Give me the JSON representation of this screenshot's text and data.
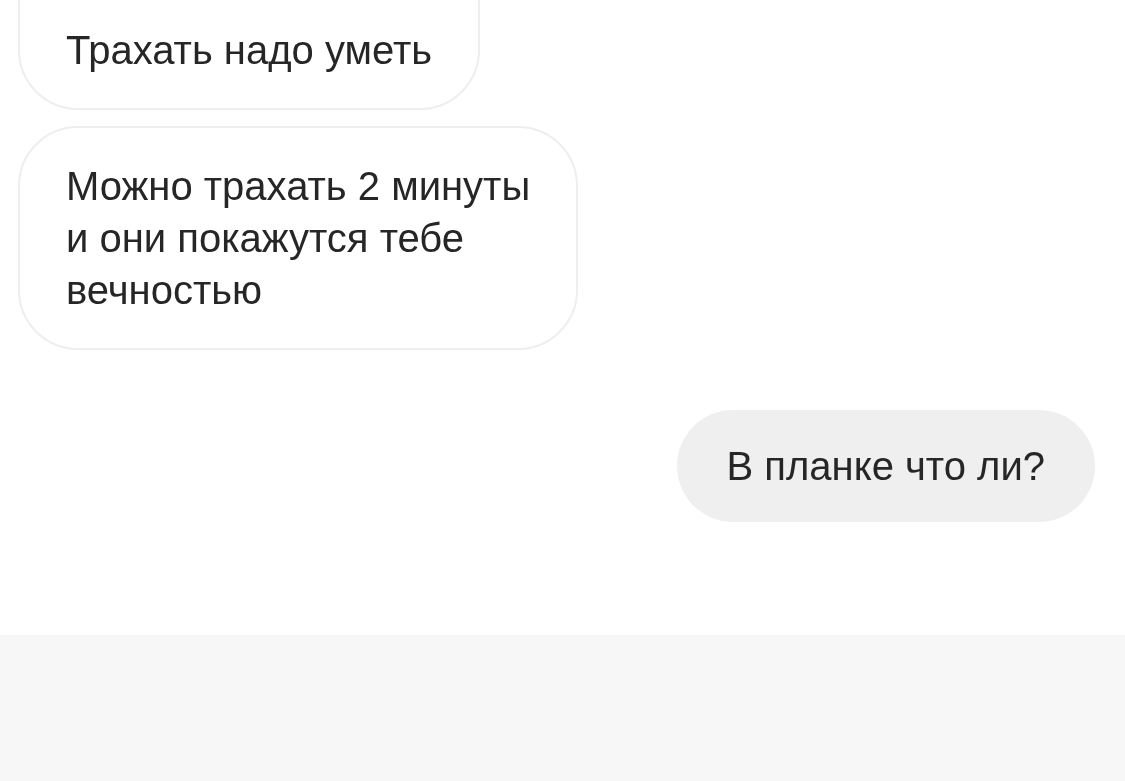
{
  "messages": [
    {
      "kind": "received",
      "text": "Трахать надо уметь"
    },
    {
      "kind": "received",
      "text": "Можно трахать 2 минуты\nи они покажутся тебе\nвечностью"
    },
    {
      "kind": "sent",
      "text": "В планке что ли?"
    }
  ]
}
